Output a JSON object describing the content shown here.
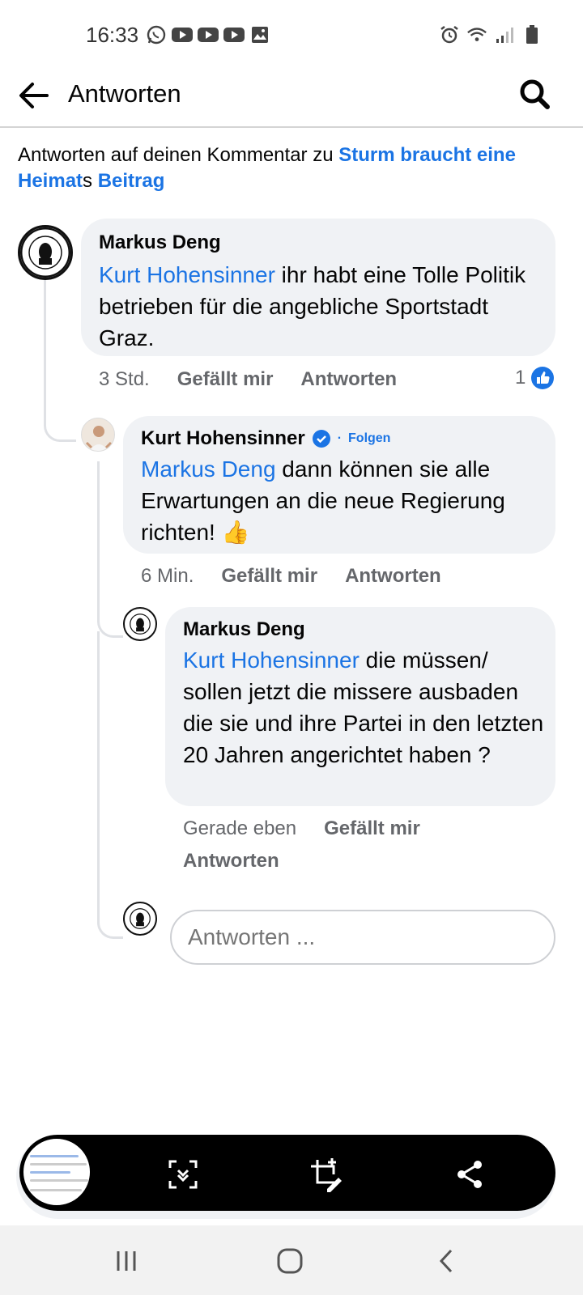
{
  "status_bar": {
    "time": "16:33",
    "left_icons": [
      "whatsapp-icon",
      "youtube-icon",
      "youtube-icon",
      "youtube-icon",
      "image-icon"
    ],
    "right_icons": [
      "alarm-icon",
      "wifi-icon",
      "signal-icon",
      "battery-icon"
    ]
  },
  "header": {
    "title": "Antworten"
  },
  "context": {
    "prefix": "Antworten auf deinen Kommentar zu ",
    "page_name_a": "Sturm braucht eine Heimat",
    "possessive": "s ",
    "post_word": "Beitrag"
  },
  "comments": [
    {
      "author": "Markus Deng",
      "mention": "Kurt Hohensinner",
      "text": " ihr habt eine Tolle Politik betrieben für die angebliche Sportstadt Graz.",
      "time": "3 Std.",
      "like_label": "Gefällt mir",
      "reply_label": "Antworten",
      "reaction_count": "1"
    },
    {
      "author": "Kurt Hohensinner",
      "follow_sep": "·",
      "follow_label": "Folgen",
      "mention": "Markus Deng",
      "text": " dann können sie alle Erwartungen an die neue Regierung richten! 👍",
      "time": "6 Min.",
      "like_label": "Gefällt mir",
      "reply_label": "Antworten"
    },
    {
      "author": "Markus Deng",
      "mention": "Kurt Hohensinner",
      "text": " die müssen/ sollen jetzt die missere ausbaden die sie und ihre Partei in den letzten 20 Jahren angerichtet haben ?",
      "time": "Gerade eben",
      "like_label": "Gefällt mir",
      "reply_label": "Antworten"
    }
  ],
  "reply_box": {
    "placeholder": "Antworten ..."
  },
  "screenshot_toolbar": {
    "icons": [
      "scroll-capture-icon",
      "crop-edit-icon",
      "share-icon"
    ]
  },
  "nav_bar": {
    "icons": [
      "recents-icon",
      "home-icon",
      "back-icon"
    ]
  },
  "colors": {
    "link": "#1b74e4",
    "bubble": "#f0f2f5",
    "meta": "#65676b"
  }
}
